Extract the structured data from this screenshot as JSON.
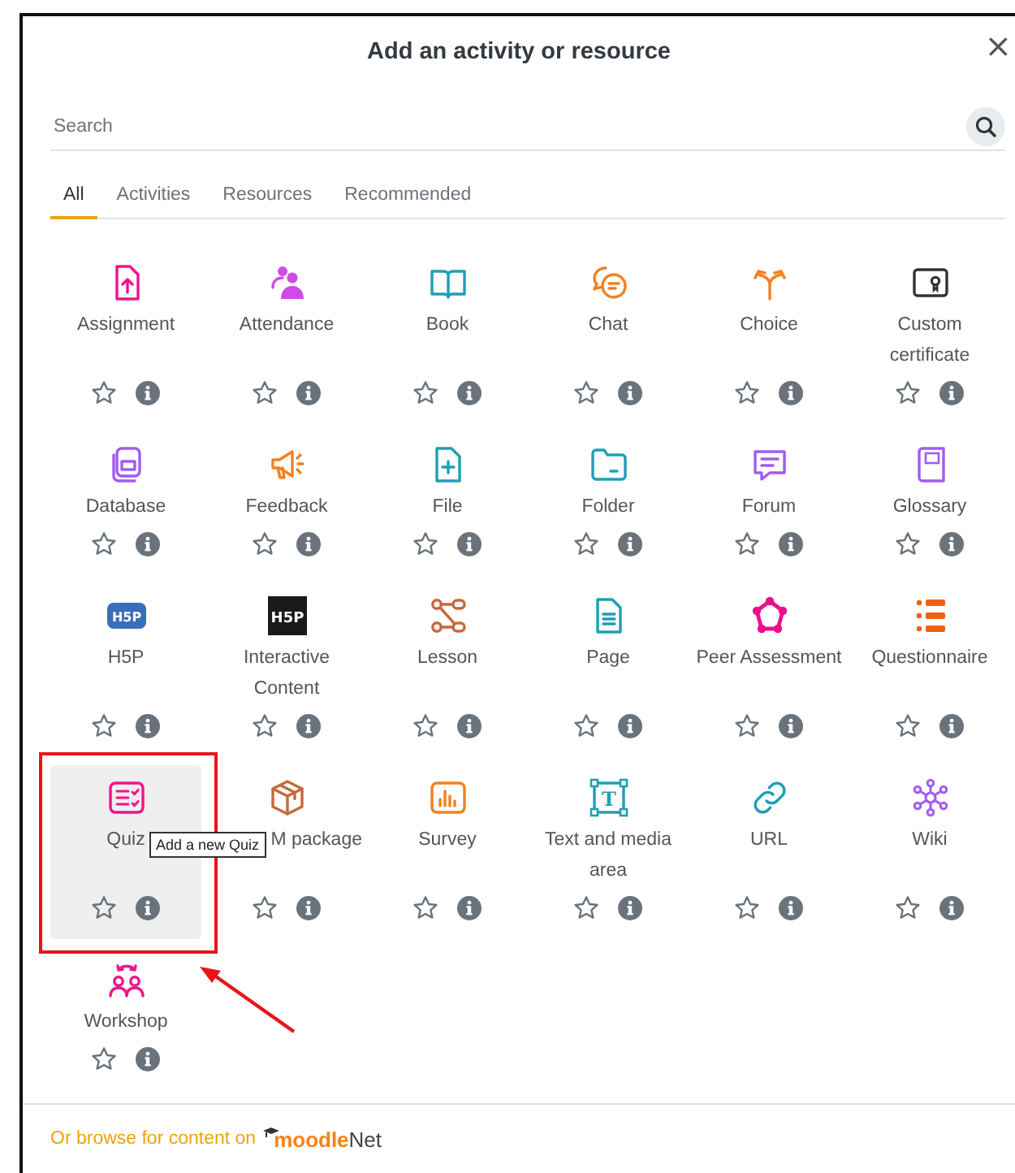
{
  "dialog": {
    "title": "Add an activity or resource",
    "close": "×"
  },
  "search": {
    "placeholder": "Search"
  },
  "tabs": [
    {
      "label": "All",
      "selected": true
    },
    {
      "label": "Activities",
      "selected": false
    },
    {
      "label": "Resources",
      "selected": false
    },
    {
      "label": "Recommended",
      "selected": false
    }
  ],
  "items": [
    {
      "label": "Assignment",
      "color": "#f0138c",
      "starred": false,
      "selected": false
    },
    {
      "label": "Attendance",
      "color": "#d04ae8",
      "starred": false,
      "selected": false
    },
    {
      "label": "Book",
      "color": "#1f9fb4",
      "starred": false,
      "selected": false
    },
    {
      "label": "Chat",
      "color": "#f5801f",
      "starred": false,
      "selected": false
    },
    {
      "label": "Choice",
      "color": "#f5801f",
      "starred": false,
      "selected": false
    },
    {
      "label": "Custom certificate",
      "color": "#333333",
      "starred": false,
      "selected": false
    },
    {
      "label": "Database",
      "color": "#a05cf2",
      "starred": false,
      "selected": false
    },
    {
      "label": "Feedback",
      "color": "#f5801f",
      "starred": false,
      "selected": false
    },
    {
      "label": "File",
      "color": "#1f9fb4",
      "starred": false,
      "selected": false
    },
    {
      "label": "Folder",
      "color": "#1f9fb4",
      "starred": false,
      "selected": false
    },
    {
      "label": "Forum",
      "color": "#a05cf2",
      "starred": false,
      "selected": false
    },
    {
      "label": "Glossary",
      "color": "#a05cf2",
      "starred": false,
      "selected": false
    },
    {
      "label": "H5P",
      "color": "#3a6eb8",
      "badge": "H5P",
      "starred": false,
      "selected": false
    },
    {
      "label": "Interactive Content",
      "color": "#1a1a1a",
      "badge": "H5P",
      "starred": false,
      "selected": false
    },
    {
      "label": "Lesson",
      "color": "#c8683c",
      "starred": false,
      "selected": false
    },
    {
      "label": "Page",
      "color": "#1f9fb4",
      "starred": false,
      "selected": false
    },
    {
      "label": "Peer Assessment",
      "color": "#ec0f8c",
      "starred": false,
      "selected": false
    },
    {
      "label": "Questionnaire",
      "color": "#f0620f",
      "starred": false,
      "selected": false
    },
    {
      "label": "Quiz",
      "color": "#f0138c",
      "starred": false,
      "selected": true,
      "tooltip": "Add a new Quiz"
    },
    {
      "label": "M package",
      "color": "#c8683c",
      "starred": false,
      "selected": false
    },
    {
      "label": "Survey",
      "color": "#f5801f",
      "starred": false,
      "selected": false
    },
    {
      "label": "Text and media area",
      "color": "#1f9fb4",
      "badge": "T",
      "starred": false,
      "selected": false
    },
    {
      "label": "URL",
      "color": "#1f9fb4",
      "starred": false,
      "selected": false
    },
    {
      "label": "Wiki",
      "color": "#a05cf2",
      "starred": false,
      "selected": false
    },
    {
      "label": "Workshop",
      "color": "#f0138c",
      "starred": false,
      "selected": false
    }
  ],
  "footer": {
    "text": "Or browse for content on",
    "logo": [
      "moodle",
      "Net"
    ]
  }
}
